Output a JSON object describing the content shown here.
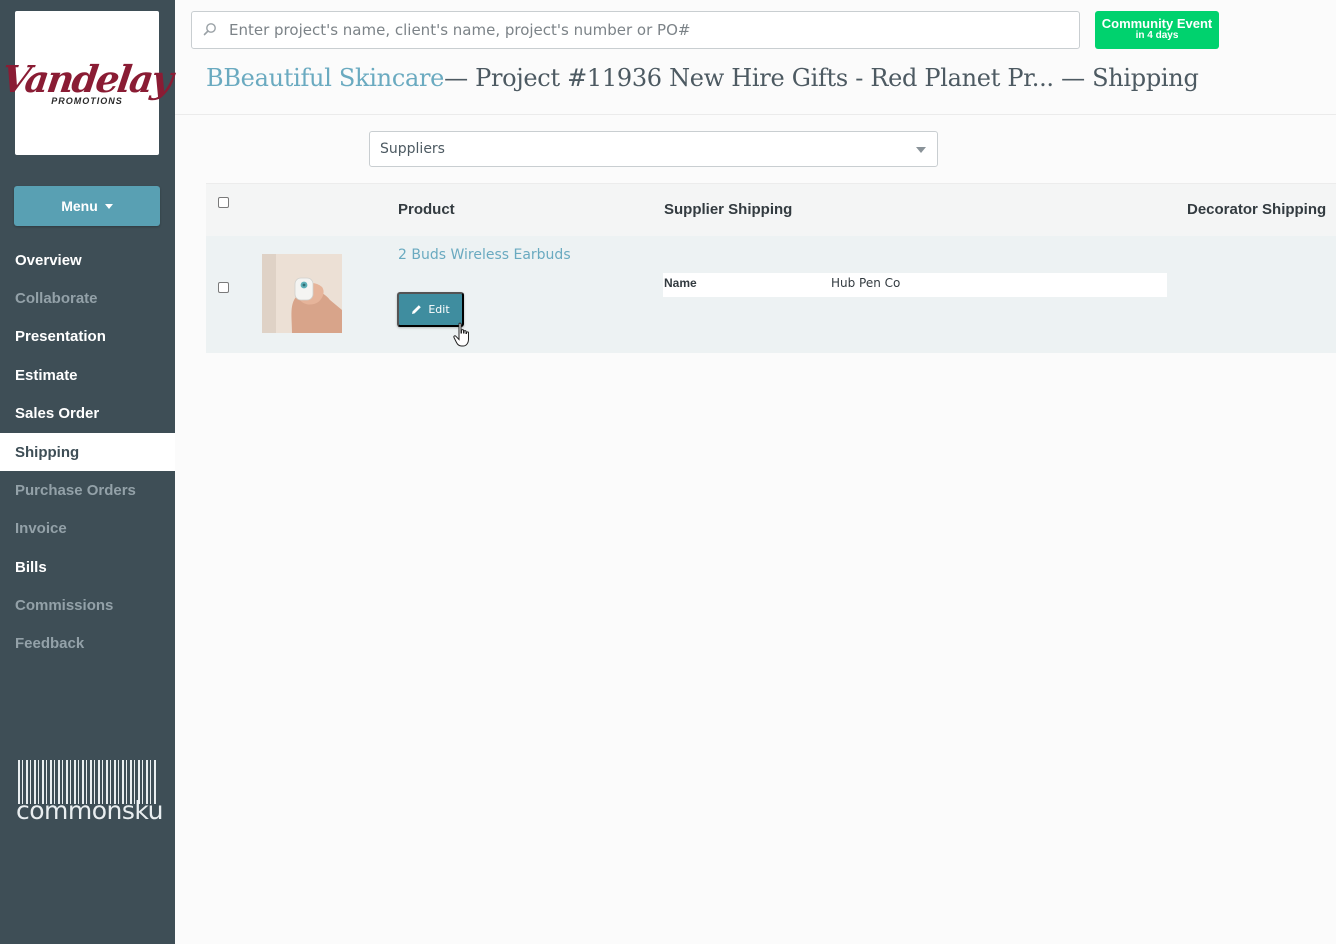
{
  "sidebar": {
    "logo": {
      "word": "Vandelay",
      "sub": "PROMOTIONS"
    },
    "menu_label": "Menu",
    "items": [
      {
        "label": "Overview",
        "state": "normal"
      },
      {
        "label": "Collaborate",
        "state": "dim"
      },
      {
        "label": "Presentation",
        "state": "normal"
      },
      {
        "label": "Estimate",
        "state": "normal"
      },
      {
        "label": "Sales Order",
        "state": "normal"
      },
      {
        "label": "Shipping",
        "state": "active"
      },
      {
        "label": "Purchase Orders",
        "state": "dim"
      },
      {
        "label": "Invoice",
        "state": "dim"
      },
      {
        "label": "Bills",
        "state": "normal"
      },
      {
        "label": "Commissions",
        "state": "dim"
      },
      {
        "label": "Feedback",
        "state": "dim"
      }
    ],
    "brand": "commonsku"
  },
  "search": {
    "placeholder": "Enter project's name, client's name, project's number or PO#"
  },
  "community_event": {
    "title": "Community Event",
    "subtitle": "in 4 days"
  },
  "header": {
    "client": "BBeautiful Skincare",
    "rest": "— Project #11936 New Hire Gifts - Red Planet Pr... — Shipping"
  },
  "filter": {
    "selected": "Suppliers"
  },
  "table": {
    "columns": {
      "product": "Product",
      "supplier_shipping": "Supplier Shipping",
      "decorator_shipping": "Decorator Shipping"
    },
    "rows": [
      {
        "product_name": "2 Buds Wireless Earbuds",
        "edit_label": "Edit",
        "supplier": {
          "label": "Name",
          "value": "Hub Pen Co"
        }
      }
    ]
  },
  "colors": {
    "sidebar_bg": "#3e4e56",
    "accent": "#59a0b3",
    "event_green": "#00d26e",
    "link": "#6aaac0"
  }
}
